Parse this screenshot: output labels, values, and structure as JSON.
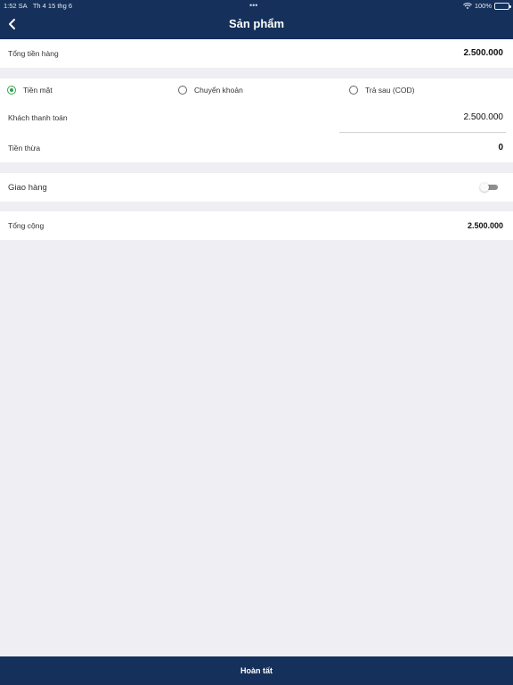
{
  "status_bar": {
    "time": "1:52 SA",
    "date": "Th 4 15 thg 6",
    "dots": "•••",
    "battery": "100%",
    "battery_level": 1.0
  },
  "header": {
    "title": "Sản phẩm",
    "back_icon": "chevron-left-icon"
  },
  "subtotal": {
    "label": "Tổng tiền hàng",
    "value": "2.500.000"
  },
  "payment": {
    "methods": [
      {
        "label": "Tiền mặt",
        "selected": true
      },
      {
        "label": "Chuyển khoản",
        "selected": false
      },
      {
        "label": "Trả sau (COD)",
        "selected": false
      }
    ],
    "customer_paid_label": "Khách thanh toán",
    "customer_paid_value": "2.500.000",
    "change_label": "Tiền thừa",
    "change_value": "0"
  },
  "delivery": {
    "label": "Giao hàng",
    "enabled": false
  },
  "total": {
    "label": "Tổng cộng",
    "value": "2.500.000"
  },
  "footer": {
    "button_label": "Hoàn tất"
  },
  "colors": {
    "header_bg": "#15305a",
    "page_bg": "#efeef3",
    "radio_selected": "#2ea44f"
  }
}
